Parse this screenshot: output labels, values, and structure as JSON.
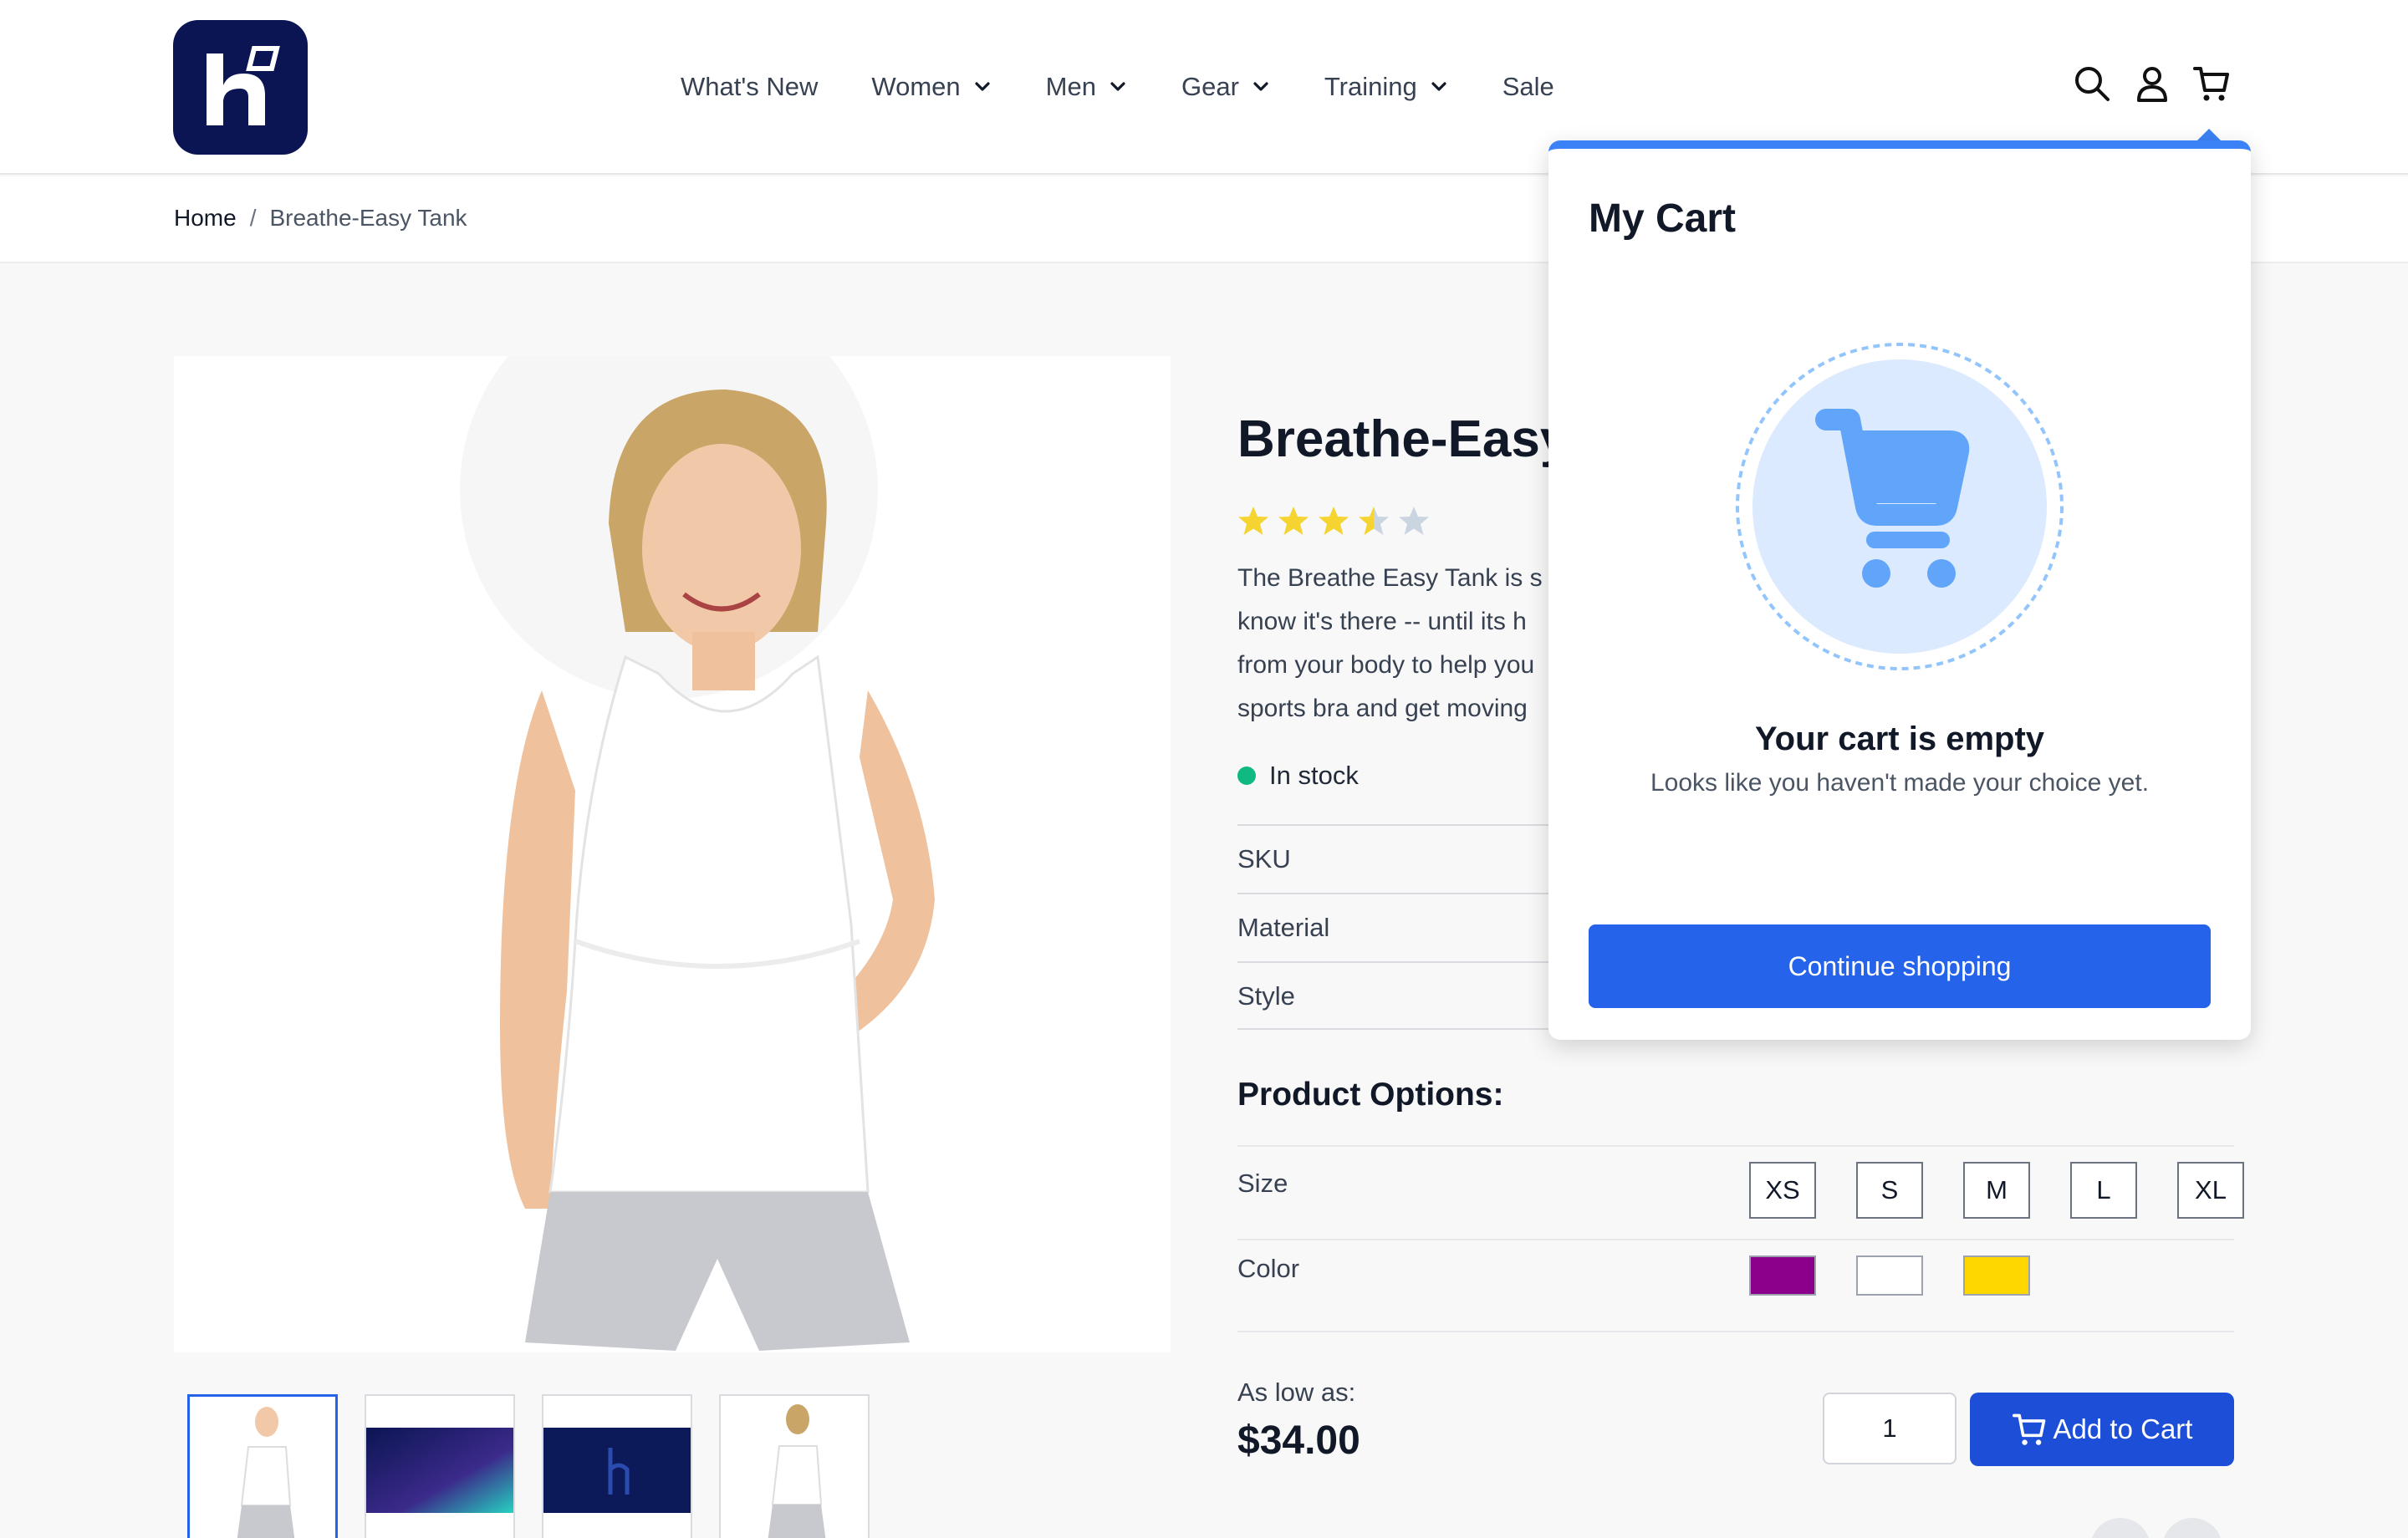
{
  "header": {
    "logo_letter": "h",
    "nav": [
      {
        "label": "What's New",
        "dropdown": false
      },
      {
        "label": "Women",
        "dropdown": true
      },
      {
        "label": "Men",
        "dropdown": true
      },
      {
        "label": "Gear",
        "dropdown": true
      },
      {
        "label": "Training",
        "dropdown": true
      },
      {
        "label": "Sale",
        "dropdown": false
      }
    ],
    "icons": [
      "search-icon",
      "user-icon",
      "cart-icon"
    ]
  },
  "breadcrumb": {
    "home": "Home",
    "separator": "/",
    "current": "Breathe-Easy Tank"
  },
  "product": {
    "title": "Breathe-Easy",
    "rating": 3.5,
    "rating_max": 5,
    "description_lines": [
      "The Breathe Easy Tank is s",
      "know it's there -- until its h",
      "from your body to help you",
      "sports bra and get moving"
    ],
    "stock": "In stock",
    "specs": [
      "SKU",
      "Material",
      "Style"
    ],
    "options_title": "Product Options:",
    "size_label": "Size",
    "sizes": [
      "XS",
      "S",
      "M",
      "L",
      "XL"
    ],
    "color_label": "Color",
    "colors": [
      "#8b008b",
      "#ffffff",
      "#ffd700"
    ],
    "price_label": "As low as:",
    "price": "$34.00",
    "quantity": "1",
    "add_to_cart": "Add to Cart"
  },
  "cart": {
    "title": "My Cart",
    "empty_title": "Your cart is empty",
    "empty_subtitle": "Looks like you haven't made your choice yet.",
    "continue_label": "Continue shopping"
  },
  "colors": {
    "brand_navy": "#0b1553",
    "accent_blue": "#2563eb",
    "star_yellow": "#f5d432",
    "stock_green": "#10b981"
  }
}
